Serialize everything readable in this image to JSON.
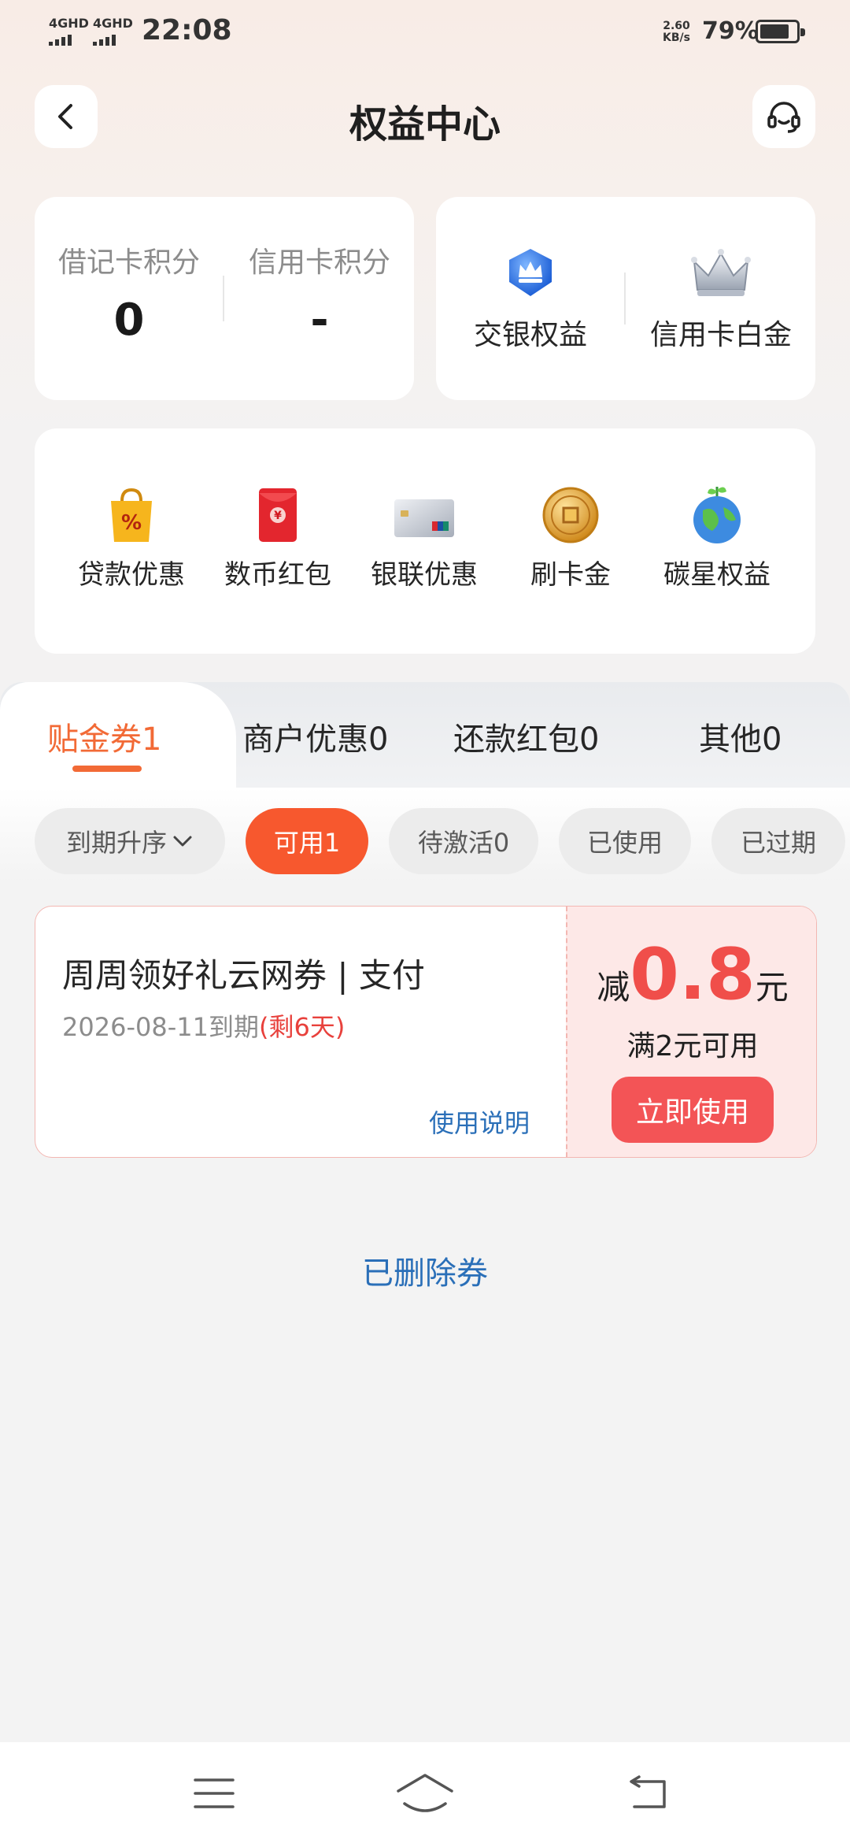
{
  "status": {
    "sig1": "4GHD",
    "sig2": "4GHD",
    "time": "22:08",
    "net_speed_value": "2.60",
    "net_speed_unit": "KB/s",
    "battery": "79%"
  },
  "header": {
    "title": "权益中心",
    "back_icon": "chevron-left-icon",
    "support_icon": "headset-icon"
  },
  "points": {
    "debit_label": "借记卡积分",
    "debit_value": "0",
    "credit_label": "信用卡积分",
    "credit_value": "-"
  },
  "perks": [
    {
      "label": "交银权益",
      "icon": "blue-crown-icon"
    },
    {
      "label": "信用卡白金",
      "icon": "silver-crown-icon"
    }
  ],
  "grid": [
    {
      "label": "贷款优惠",
      "icon": "shopping-bag-percent-icon"
    },
    {
      "label": "数币红包",
      "icon": "red-envelope-icon"
    },
    {
      "label": "银联优惠",
      "icon": "unionpay-card-icon"
    },
    {
      "label": "刷卡金",
      "icon": "gold-coin-icon"
    },
    {
      "label": "碳星权益",
      "icon": "earth-plant-icon"
    }
  ],
  "tabs": [
    {
      "label": "贴金券1",
      "active": true
    },
    {
      "label": "商户优惠0"
    },
    {
      "label": "还款红包0"
    },
    {
      "label": "其他0"
    }
  ],
  "filters": [
    {
      "label": "到期升序",
      "has_dropdown": true
    },
    {
      "label": "可用1",
      "active": true
    },
    {
      "label": "待激活0"
    },
    {
      "label": "已使用"
    },
    {
      "label": "已过期"
    }
  ],
  "coupon": {
    "title": "周周领好礼云网券 | 支付",
    "expiry": "2026-08-11到期",
    "remaining": "(剩6天)",
    "help": "使用说明",
    "prefix": "减",
    "amount": "0.8",
    "suffix": "元",
    "condition": "满2元可用",
    "use_button": "立即使用"
  },
  "deleted_link": "已删除券",
  "colors": {
    "accent": "#f26a36",
    "chip_active": "#f7582e",
    "coupon_red": "#f04e4a",
    "link_blue": "#2a6fb8"
  }
}
